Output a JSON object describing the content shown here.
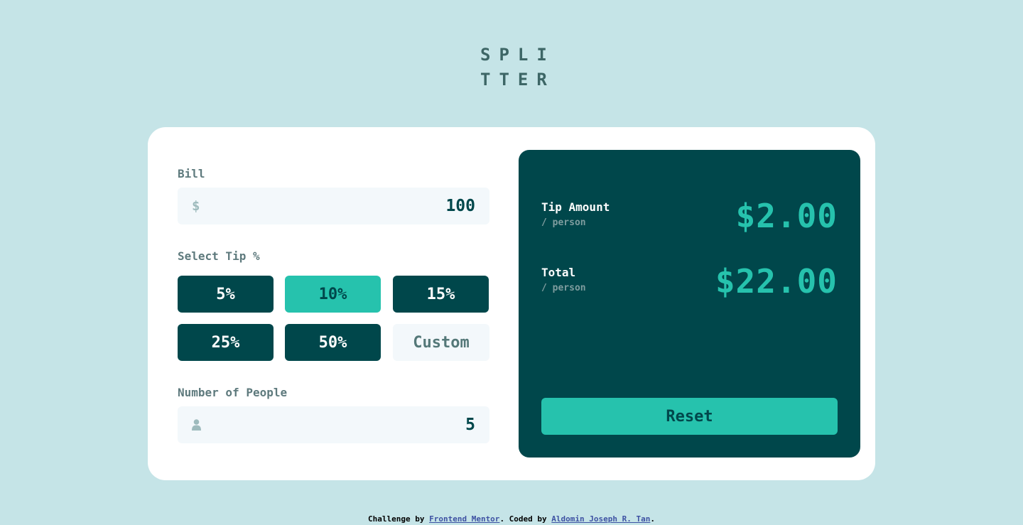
{
  "logo": {
    "line1": "SPLI",
    "line2": "TTER"
  },
  "bill": {
    "label": "Bill",
    "icon": "dollar-icon",
    "icon_glyph": "$",
    "value": "100"
  },
  "tip": {
    "label": "Select Tip %",
    "options": [
      "5%",
      "10%",
      "15%",
      "25%",
      "50%"
    ],
    "selected": "10%",
    "custom_placeholder": "Custom"
  },
  "people": {
    "label": "Number of People",
    "icon": "person-icon",
    "value": "5"
  },
  "results": {
    "tip_label": "Tip Amount",
    "tip_sub": "/ person",
    "tip_value": "$2.00",
    "total_label": "Total",
    "total_sub": "/ person",
    "total_value": "$22.00",
    "reset_label": "Reset"
  },
  "footer": {
    "prefix": "Challenge by ",
    "link1": "Frontend Mentor",
    "middle": ". Coded by ",
    "link2": "Aldomin Joseph R. Tan",
    "suffix": "."
  },
  "colors": {
    "background": "#c5e4e7",
    "dark_cyan": "#00474b",
    "strong_cyan": "#26c2ad",
    "field_bg": "#f3f8fb"
  }
}
